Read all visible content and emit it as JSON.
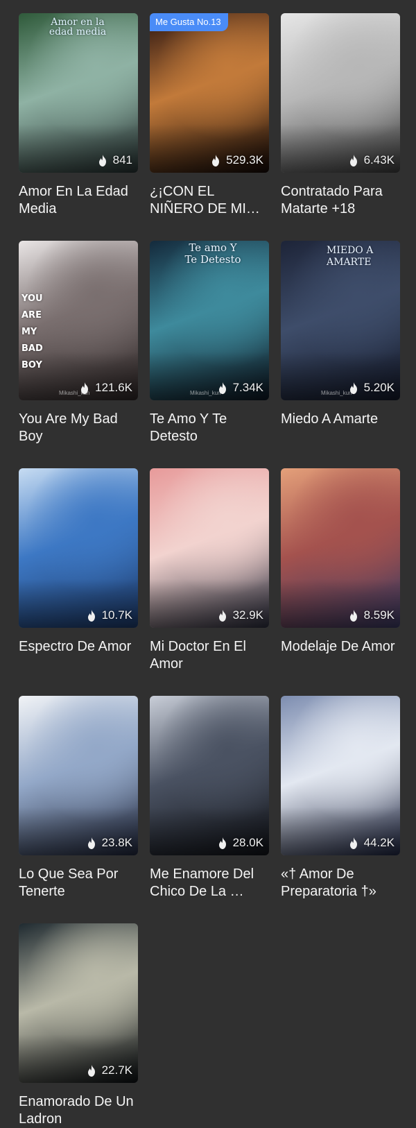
{
  "books": [
    {
      "title": "Amor En La Edad Media",
      "views": "841",
      "cover_text": "Amor en la edad media",
      "badge": "",
      "watermark": "",
      "colors": [
        "#2f5a3a",
        "#8fb2a4",
        "#253030"
      ]
    },
    {
      "title": "¿¡CON EL NIÑERO DE MIS HIJOS!?…",
      "views": "529.3K",
      "cover_text": "",
      "badge": "Me Gusta No.13",
      "watermark": "",
      "colors": [
        "#2a1410",
        "#c27a3a",
        "#120806"
      ]
    },
    {
      "title": "Contratado Para Matarte +18",
      "views": "6.43K",
      "cover_text": "",
      "badge": "",
      "watermark": "",
      "colors": [
        "#e6e6e6",
        "#b7b7b7",
        "#3a3a3a"
      ]
    },
    {
      "title": "You Are My Bad Boy",
      "views": "121.6K",
      "cover_text": "YOU ARE MY BAD BOY",
      "badge": "",
      "watermark": "Mikashi_kun",
      "colors": [
        "#e9e5e5",
        "#7a6f6f",
        "#2b2424"
      ]
    },
    {
      "title": "Te Amo Y Te Detesto",
      "views": "7.34K",
      "cover_text": "Te amo Y Te Detesto",
      "badge": "",
      "watermark": "Mikashi_kun",
      "colors": [
        "#142a3c",
        "#3e8a9c",
        "#0c1520"
      ]
    },
    {
      "title": "Miedo A Amarte",
      "views": "5.20K",
      "cover_text": "MIEDO A AMARTE",
      "badge": "",
      "watermark": "Mikashi_kun",
      "colors": [
        "#1d2438",
        "#3e4d6a",
        "#131828"
      ]
    },
    {
      "title": "Espectro De Amor",
      "views": "10.7K",
      "cover_text": "",
      "badge": "",
      "watermark": "",
      "colors": [
        "#c7dcf2",
        "#3d78c4",
        "#1c3866"
      ]
    },
    {
      "title": "Mi Doctor En El Amor",
      "views": "32.9K",
      "cover_text": "",
      "badge": "",
      "watermark": "",
      "colors": [
        "#e79a9a",
        "#f2d3cf",
        "#2a2c3b"
      ]
    },
    {
      "title": "Modelaje De Amor",
      "views": "8.59K",
      "cover_text": "",
      "badge": "",
      "watermark": "",
      "colors": [
        "#e4a07a",
        "#a4524e",
        "#383860"
      ]
    },
    {
      "title": "Lo Que Sea Por Tenerte",
      "views": "23.8K",
      "cover_text": "",
      "badge": "",
      "watermark": "",
      "colors": [
        "#f1f3f6",
        "#93a8c8",
        "#20263a"
      ]
    },
    {
      "title": "Me Enamore Del Chico De La …",
      "views": "28.0K",
      "cover_text": "",
      "badge": "",
      "watermark": "",
      "colors": [
        "#c9ced8",
        "#4a5262",
        "#111318"
      ]
    },
    {
      "title": "«† Amor De Preparatoria †»",
      "views": "44.2K",
      "cover_text": "",
      "badge": "",
      "watermark": "",
      "colors": [
        "#7d8db0",
        "#e3e8f1",
        "#1e2540"
      ]
    },
    {
      "title": "Enamorado De Un Ladron",
      "views": "22.7K",
      "cover_text": "",
      "badge": "",
      "watermark": "",
      "colors": [
        "#1f2a30",
        "#b9b9a8",
        "#0b0f12"
      ]
    }
  ]
}
